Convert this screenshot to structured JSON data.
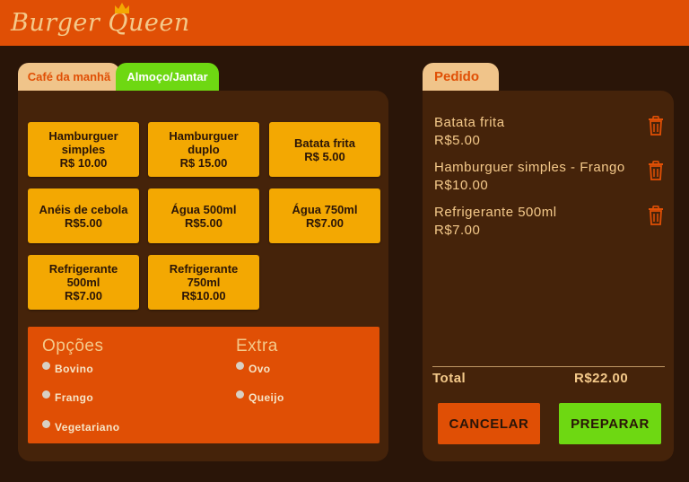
{
  "app": {
    "brand": "Burger Queen"
  },
  "menu": {
    "tabs": [
      {
        "label": "Café da manhã",
        "active": false
      },
      {
        "label": "Almoço/Jantar",
        "active": true
      }
    ],
    "items": [
      {
        "name": "Hamburguer simples",
        "price": "R$ 10.00"
      },
      {
        "name": "Hamburguer duplo",
        "price": "R$ 15.00"
      },
      {
        "name": "Batata frita",
        "price": "R$ 5.00"
      },
      {
        "name": "Anéis de cebola",
        "price": "R$5.00"
      },
      {
        "name": "Água 500ml",
        "price": "R$5.00"
      },
      {
        "name": "Água 750ml",
        "price": "R$7.00"
      },
      {
        "name": "Refrigerante 500ml",
        "price": "R$7.00"
      },
      {
        "name": "Refrigerante 750ml",
        "price": "R$10.00"
      }
    ]
  },
  "options": {
    "title": "Opções",
    "choices": [
      "Bovino",
      "Frango",
      "Vegetariano"
    ]
  },
  "extra": {
    "title": "Extra",
    "choices": [
      "Ovo",
      "Queijo"
    ]
  },
  "order": {
    "tab_label": "Pedido",
    "items": [
      {
        "name": "Batata frita",
        "price": "R$5.00"
      },
      {
        "name": "Hamburguer simples - Frango",
        "price": "R$10.00"
      },
      {
        "name": "Refrigerante 500ml",
        "price": "R$7.00"
      }
    ],
    "total_label": "Total",
    "total_value": "R$22.00",
    "cancel_label": "CANCELAR",
    "prepare_label": "PREPARAR"
  },
  "colors": {
    "background": "#2a1508",
    "header": "#e04f05",
    "panel": "#45230a",
    "item": "#f3a802",
    "accent_green": "#6ed812",
    "text_light": "#f4c98a"
  }
}
